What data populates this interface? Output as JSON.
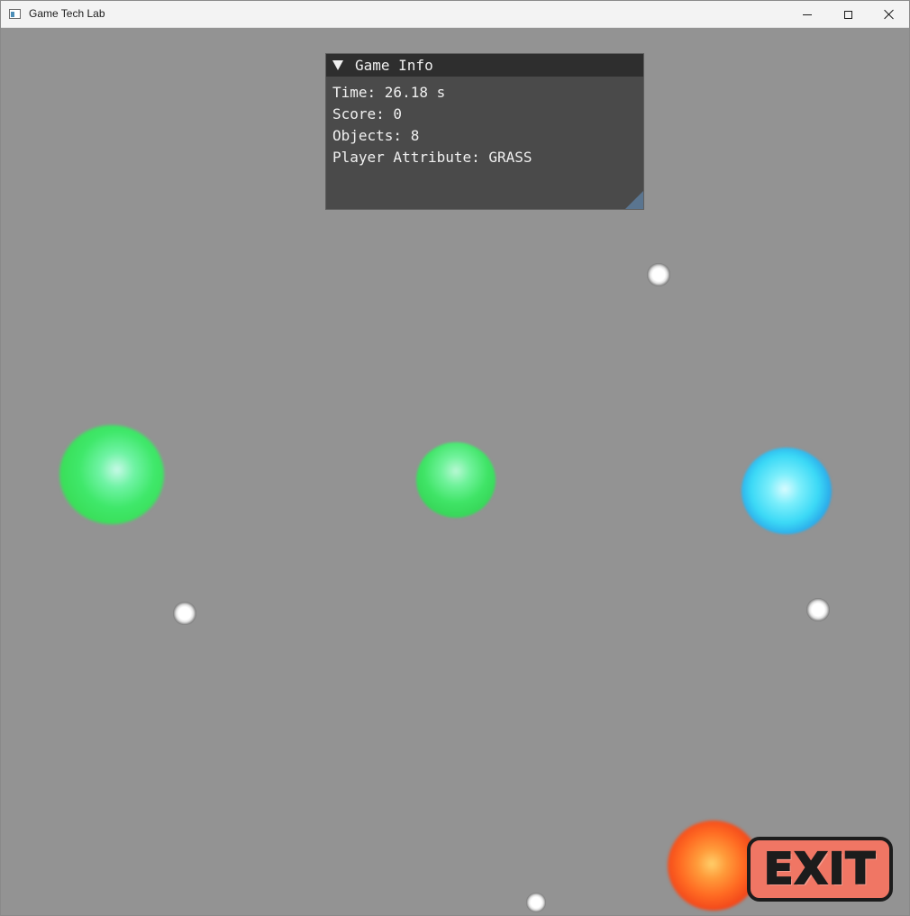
{
  "window": {
    "title": "Game Tech Lab"
  },
  "game_info": {
    "title": "Game Info",
    "time_line": "Time: 26.18 s",
    "score_line": "Score: 0",
    "objects_line": "Objects: 8",
    "attribute_line": "Player Attribute: GRASS"
  },
  "objects": [
    {
      "kind": "orb",
      "color": "green"
    },
    {
      "kind": "orb",
      "color": "green"
    },
    {
      "kind": "orb",
      "color": "blue"
    },
    {
      "kind": "player-orb",
      "color": "red"
    },
    {
      "kind": "pellet",
      "color": "white"
    },
    {
      "kind": "pellet",
      "color": "white"
    },
    {
      "kind": "pellet",
      "color": "white"
    },
    {
      "kind": "pellet",
      "color": "white"
    }
  ],
  "exit_button": {
    "label": "EXIT",
    "color": "#f07664"
  },
  "colors": {
    "background": "#939393",
    "panel": "#454545",
    "panel_header": "#2e2e2e",
    "resize_grip": "#5a7590"
  }
}
